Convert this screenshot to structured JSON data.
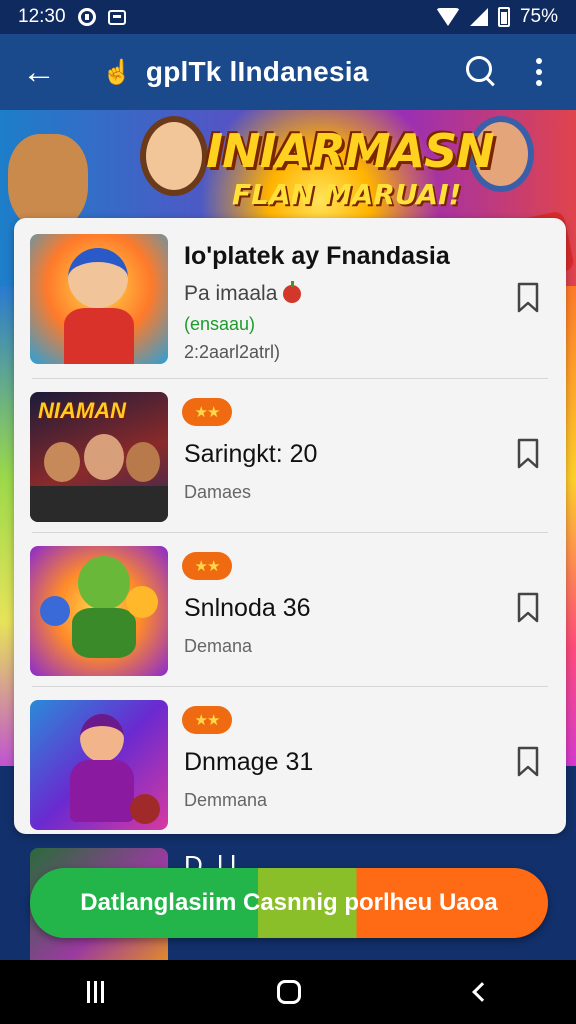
{
  "status_bar": {
    "time": "12:30",
    "battery": "75%"
  },
  "app_bar": {
    "title": "gplTk lIndanesia"
  },
  "banner": {
    "title": "INIARMASN",
    "subtitle": "FLAN MARUAI!"
  },
  "items": [
    {
      "title": "Io'platek ay Fnandasia",
      "subtitle": "Pa imaala",
      "status": "(ensaau)",
      "meta": "2:2aarl2atrl)"
    },
    {
      "title": "Saringkt: 20",
      "subtitle": "Damaes"
    },
    {
      "title": "Snlnoda 36",
      "subtitle": "Demana"
    },
    {
      "title": "Dnmage 31",
      "subtitle": "Demmana"
    }
  ],
  "item2_thumb_label": "NIAMAN",
  "partial_item": {
    "title": "D..l.l..."
  },
  "cta": {
    "label": "Datlanglasiim  Casnnig porlheu Uaoa"
  },
  "colors": {
    "app_bar": "#1a4a8c",
    "cta_green": "#23b44a",
    "cta_orange": "#ff6a14",
    "badge": "#f06a12"
  },
  "icons": [
    "back-arrow-icon",
    "thumb-up-icon",
    "search-icon",
    "more-vert-icon",
    "bookmark-icon",
    "star-badge-icon",
    "recents-icon",
    "home-icon",
    "nav-back-icon"
  ]
}
